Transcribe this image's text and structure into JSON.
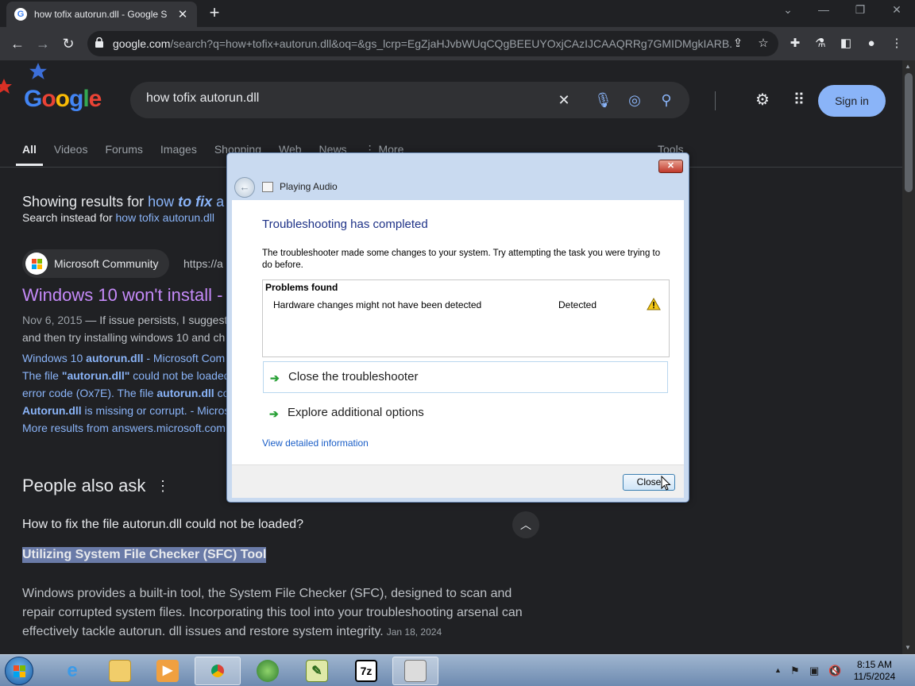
{
  "browser": {
    "tab_title": "how tofix autorun.dll - Google S",
    "url_host": "google.com",
    "url_path": "/search?q=how+tofix+autorun.dll&oq=&gs_lcrp=EgZjaHJvbWUqCQgBEEUYOxjCAzIJCAAQRRg7GMIDMgkIARB..."
  },
  "google": {
    "query": "how tofix autorun.dll",
    "sign_in": "Sign in",
    "filters": [
      "All",
      "Videos",
      "Forums",
      "Images",
      "Shopping",
      "Web",
      "News",
      "More"
    ],
    "tools": "Tools",
    "spelling": {
      "showing_prefix": "Showing results for ",
      "corrected_a": "how ",
      "corrected_b": "to fix",
      "corrected_c": " a",
      "instead_prefix": "Search instead for ",
      "instead_query": "how tofix autorun.dll"
    },
    "result": {
      "source": "Microsoft Community",
      "url": "https://a",
      "title": "Windows 10 won't install -",
      "date": "Nov 6, 2015",
      "snippet_line1": " — If issue persists, I suggest",
      "snippet_line2": "and then try installing windows 10 and ch",
      "sub_links": [
        "Windows 10 autorun.dll - Microsoft Com",
        "The file \"autorun.dll\" could not be loaded",
        "error code (Ox7E). The file autorun.dll co",
        "Autorun.dll is missing or corrupt. - Micros",
        "More results from answers.microsoft.com"
      ]
    },
    "paa": {
      "title": "People also ask",
      "question": "How to fix the file autorun.dll could not be loaded?",
      "answer_heading": "Utilizing System File Checker (SFC) Tool",
      "answer_text": "Windows provides a built-in tool, the System File Checker (SFC), designed to scan and repair corrupted system files. Incorporating this tool into your troubleshooting arsenal can effectively tackle autorun. dll issues and restore system integrity.",
      "answer_date": "Jan 18, 2024"
    }
  },
  "dialog": {
    "window_title": "Playing Audio",
    "heading": "Troubleshooting has completed",
    "description": "The troubleshooter made some changes to your system. Try attempting the task you were trying to do before.",
    "problems_header": "Problems found",
    "problem_name": "Hardware changes might not have been detected",
    "problem_status": "Detected",
    "option_close": "Close the troubleshooter",
    "option_explore": "Explore additional options",
    "details_link": "View detailed information",
    "close_button": "Close"
  },
  "taskbar": {
    "time": "8:15 AM",
    "date": "11/5/2024",
    "apps": [
      "internet-explorer",
      "file-explorer",
      "media-player",
      "chrome",
      "download-manager",
      "notepad-plus-plus",
      "7-zip",
      "troubleshooter"
    ],
    "seven_zip_label": "7z"
  },
  "colors": {
    "page_bg": "#202124",
    "link": "#8ab4f8",
    "visited": "#c58af9",
    "dialog_heading": "#1e3287"
  }
}
